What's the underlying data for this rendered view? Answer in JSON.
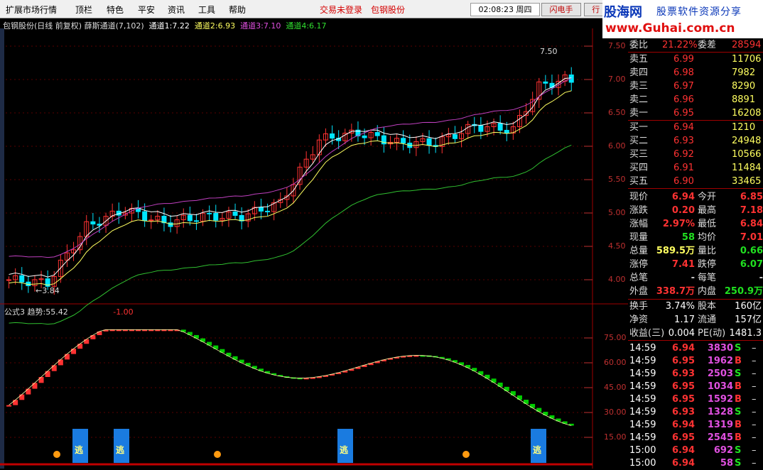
{
  "menu": {
    "items": [
      "扩展市场行情",
      "顶栏",
      "特色",
      "平安",
      "资讯",
      "工具",
      "帮助"
    ],
    "status": "交易未登录",
    "stock": "包钢股份",
    "time": "02:08:23",
    "weekday": "周四",
    "btn_flash": "闪电手",
    "btn_quote": "行 情"
  },
  "logo": {
    "brand": "股海网",
    "slogan": "股票软件资源分享",
    "url": "www.Guhai.com.cn"
  },
  "chart": {
    "title": "包钢股份(日线 前复权)",
    "indicator": "薛斯通道(7,102)",
    "ch1_label": "通道1:",
    "ch1": "7.22",
    "ch2_label": "通道2:",
    "ch2": "6.93",
    "ch3_label": "通道3:",
    "ch3": "7.10",
    "ch4_label": "通道4:",
    "ch4": "6.17",
    "high_mark": "7.50",
    "low_mark": "3.84",
    "yticks": [
      "7.50",
      "7.00",
      "6.50",
      "6.00",
      "5.50",
      "5.00",
      "4.50",
      "4.00"
    ]
  },
  "ind": {
    "name": "公式3",
    "trend_label": "趋势:",
    "trend": "55.42",
    "mark": "-1.00",
    "yticks": [
      "75.00",
      "60.00",
      "45.00",
      "30.00",
      "15.00"
    ],
    "signal": "逃"
  },
  "colors": {
    "up": "#ff3232",
    "down": "#00e5ff",
    "green_bar": "#00cc00",
    "purple": "#c040c0",
    "yellow": "#ffff60"
  },
  "quote": {
    "webi": {
      "label": "委比",
      "value": "21.22%",
      "label2": "委差",
      "value2": "28594"
    },
    "asks": [
      {
        "name": "卖五",
        "price": "6.99",
        "vol": "11706"
      },
      {
        "name": "卖四",
        "price": "6.98",
        "vol": "7982"
      },
      {
        "name": "卖三",
        "price": "6.97",
        "vol": "8290"
      },
      {
        "name": "卖二",
        "price": "6.96",
        "vol": "8891"
      },
      {
        "name": "卖一",
        "price": "6.95",
        "vol": "16208"
      }
    ],
    "bids": [
      {
        "name": "买一",
        "price": "6.94",
        "vol": "1210"
      },
      {
        "name": "买二",
        "price": "6.93",
        "vol": "24948"
      },
      {
        "name": "买三",
        "price": "6.92",
        "vol": "10566"
      },
      {
        "name": "买四",
        "price": "6.91",
        "vol": "11484"
      },
      {
        "name": "买五",
        "price": "6.90",
        "vol": "33465"
      }
    ],
    "stats": [
      {
        "l": "现价",
        "v": "6.94",
        "l2": "今开",
        "v2": "6.85",
        "c": "#ff3232",
        "c2": "#ff3232"
      },
      {
        "l": "涨跌",
        "v": "0.20",
        "l2": "最高",
        "v2": "7.18",
        "c": "#ff3232",
        "c2": "#ff3232"
      },
      {
        "l": "涨幅",
        "v": "2.97%",
        "l2": "最低",
        "v2": "6.84",
        "c": "#ff3232",
        "c2": "#ff3232"
      },
      {
        "l": "现量",
        "v": "58",
        "l2": "均价",
        "v2": "7.01",
        "c": "#20e020",
        "c2": "#ff3232"
      },
      {
        "l": "总量",
        "v": "589.5万",
        "l2": "量比",
        "v2": "0.66",
        "c": "#ffff60",
        "c2": "#20e020"
      },
      {
        "l": "涨停",
        "v": "7.41",
        "l2": "跌停",
        "v2": "6.07",
        "c": "#ff3232",
        "c2": "#20e020"
      },
      {
        "l": "总笔",
        "v": "-",
        "l2": "每笔",
        "v2": "-",
        "c": "#ccc",
        "c2": "#ccc"
      },
      {
        "l": "外盘",
        "v": "338.7万",
        "l2": "内盘",
        "v2": "250.9万",
        "c": "#ff3232",
        "c2": "#20e020"
      }
    ],
    "fin": [
      {
        "l": "换手",
        "v": "3.74%",
        "l2": "股本",
        "v2": "160亿"
      },
      {
        "l": "净资",
        "v": "1.17",
        "l2": "流通",
        "v2": "157亿"
      },
      {
        "l": "收益(三)",
        "v": "0.004",
        "l2": "PE(动)",
        "v2": "1481.3"
      }
    ],
    "ticks": [
      {
        "t": "14:59",
        "p": "6.94",
        "v": "3830",
        "s": "S"
      },
      {
        "t": "14:59",
        "p": "6.95",
        "v": "1962",
        "s": "B"
      },
      {
        "t": "14:59",
        "p": "6.93",
        "v": "2503",
        "s": "S"
      },
      {
        "t": "14:59",
        "p": "6.95",
        "v": "1034",
        "s": "B"
      },
      {
        "t": "14:59",
        "p": "6.95",
        "v": "1592",
        "s": "B"
      },
      {
        "t": "14:59",
        "p": "6.93",
        "v": "1328",
        "s": "S"
      },
      {
        "t": "14:59",
        "p": "6.94",
        "v": "1319",
        "s": "B"
      },
      {
        "t": "14:59",
        "p": "6.95",
        "v": "2545",
        "s": "B"
      },
      {
        "t": "15:00",
        "p": "6.94",
        "v": "692",
        "s": "S"
      },
      {
        "t": "15:00",
        "p": "6.94",
        "v": "58",
        "s": "S"
      }
    ]
  }
}
